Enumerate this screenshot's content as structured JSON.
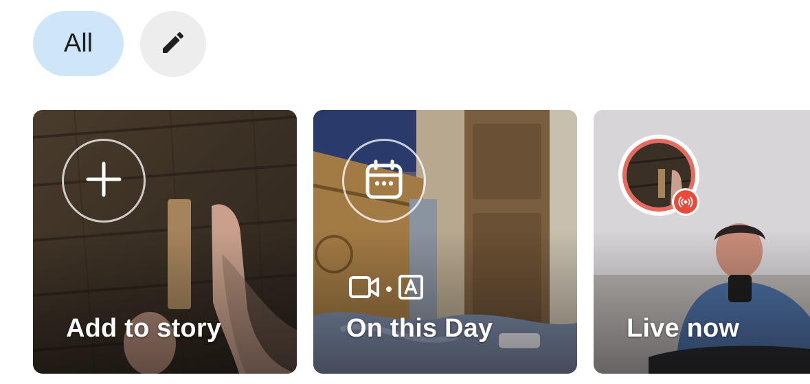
{
  "filters": {
    "all_label": "All",
    "edit_icon": "pencil-icon"
  },
  "cards": [
    {
      "label": "Add to story",
      "icon": "plus-icon"
    },
    {
      "label": "On this Day",
      "icon": "calendar-icon",
      "meta_icons": [
        "video-icon",
        "auto-icon"
      ]
    },
    {
      "label": "Live now",
      "icon": "live-broadcast-icon"
    }
  ],
  "colors": {
    "chip_all_bg": "#cfe6f8",
    "chip_edit_bg": "#ededed",
    "live_ring": "#e96a5d",
    "live_badge": "#ea4a3a"
  }
}
